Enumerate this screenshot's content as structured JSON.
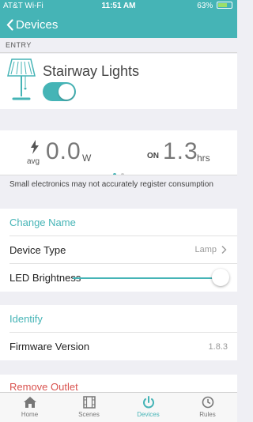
{
  "status": {
    "carrier": "AT&T Wi-Fi",
    "time": "11:51 AM",
    "battery": "63%"
  },
  "nav": {
    "back_label": "Devices"
  },
  "section": {
    "label": "ENTRY"
  },
  "device": {
    "name": "Stairway Lights",
    "on": true
  },
  "energy": {
    "avg_label": "avg",
    "power_value": "0.0",
    "power_unit": "W",
    "on_label": "ON",
    "on_value": "1.3",
    "on_unit": "hrs",
    "page_dots": 2,
    "active_dot": 1
  },
  "note": "Small electronics may not accurately register consumption",
  "settings": {
    "change_name": "Change Name",
    "device_type_label": "Device Type",
    "device_type_value": "Lamp",
    "led_label": "LED Brightness",
    "led_level_percent": 100,
    "identify": "Identify",
    "firmware_label": "Firmware Version",
    "firmware_value": "1.8.3",
    "remove": "Remove Outlet"
  },
  "tabs": [
    {
      "label": "Home",
      "icon": "home-icon",
      "active": false
    },
    {
      "label": "Scenes",
      "icon": "film-icon",
      "active": false
    },
    {
      "label": "Devices",
      "icon": "power-icon",
      "active": true
    },
    {
      "label": "Rules",
      "icon": "clock-icon",
      "active": false
    }
  ],
  "colors": {
    "accent": "#45b4b6",
    "danger": "#d9534f",
    "background": "#efeff4"
  }
}
